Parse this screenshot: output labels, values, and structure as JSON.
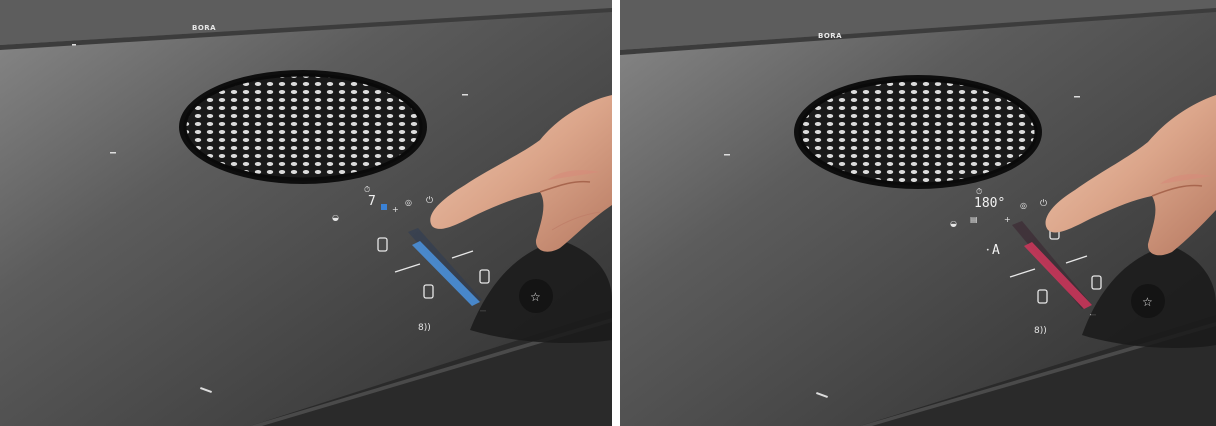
{
  "panels": [
    {
      "brand": "BORA",
      "display_value": "7",
      "slider_color": "#4a8fd8",
      "mode_icon_color": "#3b82d6",
      "power_level_fraction": 0.85
    },
    {
      "brand": "BORA",
      "display_value": "180°",
      "mode_letter": "A",
      "slider_color": "#c8365a",
      "power_level_fraction": 0.75
    }
  ],
  "icons": {
    "star": "star-icon",
    "signal": "signal-icon",
    "timer": "timer-icon"
  }
}
